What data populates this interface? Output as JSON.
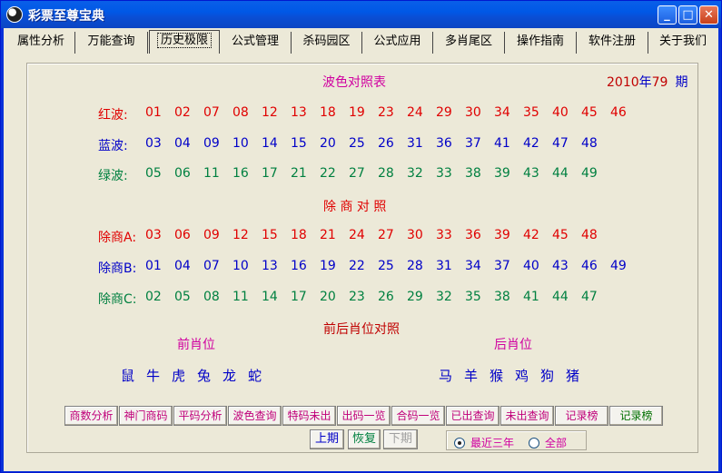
{
  "window": {
    "title": "彩票至尊宝典",
    "min": "_",
    "max": "□",
    "close": "✕"
  },
  "tabs": [
    "属性分析",
    "万能查询",
    "历史极限",
    "公式管理",
    "杀码园区",
    "公式应用",
    "多肖尾区",
    "操作指南",
    "软件注册",
    "关于我们"
  ],
  "header": {
    "title": "波色对照表",
    "year": "2010",
    "year_suffix": "年",
    "period_num": "79",
    "period_suffix": "期"
  },
  "bose": {
    "red": {
      "label": "红波:",
      "nums": [
        "01",
        "02",
        "07",
        "08",
        "12",
        "13",
        "18",
        "19",
        "23",
        "24",
        "29",
        "30",
        "34",
        "35",
        "40",
        "45",
        "46"
      ]
    },
    "blue": {
      "label": "蓝波:",
      "nums": [
        "03",
        "04",
        "09",
        "10",
        "14",
        "15",
        "20",
        "25",
        "26",
        "31",
        "36",
        "37",
        "41",
        "42",
        "47",
        "48"
      ]
    },
    "green": {
      "label": "绿波:",
      "nums": [
        "05",
        "06",
        "11",
        "16",
        "17",
        "21",
        "22",
        "27",
        "28",
        "32",
        "33",
        "38",
        "39",
        "43",
        "44",
        "49"
      ]
    }
  },
  "chushang": {
    "title": "除 商 对 照",
    "a": {
      "label": "除商A:",
      "nums": [
        "03",
        "06",
        "09",
        "12",
        "15",
        "18",
        "21",
        "24",
        "27",
        "30",
        "33",
        "36",
        "39",
        "42",
        "45",
        "48"
      ]
    },
    "b": {
      "label": "除商B:",
      "nums": [
        "01",
        "04",
        "07",
        "10",
        "13",
        "16",
        "19",
        "22",
        "25",
        "28",
        "31",
        "34",
        "37",
        "40",
        "43",
        "46",
        "49"
      ]
    },
    "c": {
      "label": "除商C:",
      "nums": [
        "02",
        "05",
        "08",
        "11",
        "14",
        "17",
        "20",
        "23",
        "26",
        "29",
        "32",
        "35",
        "38",
        "41",
        "44",
        "47"
      ]
    }
  },
  "shengxiao": {
    "title": "前后肖位对照",
    "front_title": "前肖位",
    "front": [
      "鼠",
      "牛",
      "虎",
      "兔",
      "龙",
      "蛇"
    ],
    "back_title": "后肖位",
    "back": [
      "马",
      "羊",
      "猴",
      "鸡",
      "狗",
      "猪"
    ]
  },
  "buttons": [
    "商数分析",
    "神门商码",
    "平码分析",
    "波色查询",
    "特码未出",
    "出码一览",
    "合码一览",
    "已出查询",
    "未出查询",
    "记录榜",
    "记录榜"
  ],
  "nav": {
    "prev": "上期",
    "restore": "恢复",
    "next": "下期"
  },
  "range": {
    "recent": "最近三年",
    "all": "全部"
  }
}
